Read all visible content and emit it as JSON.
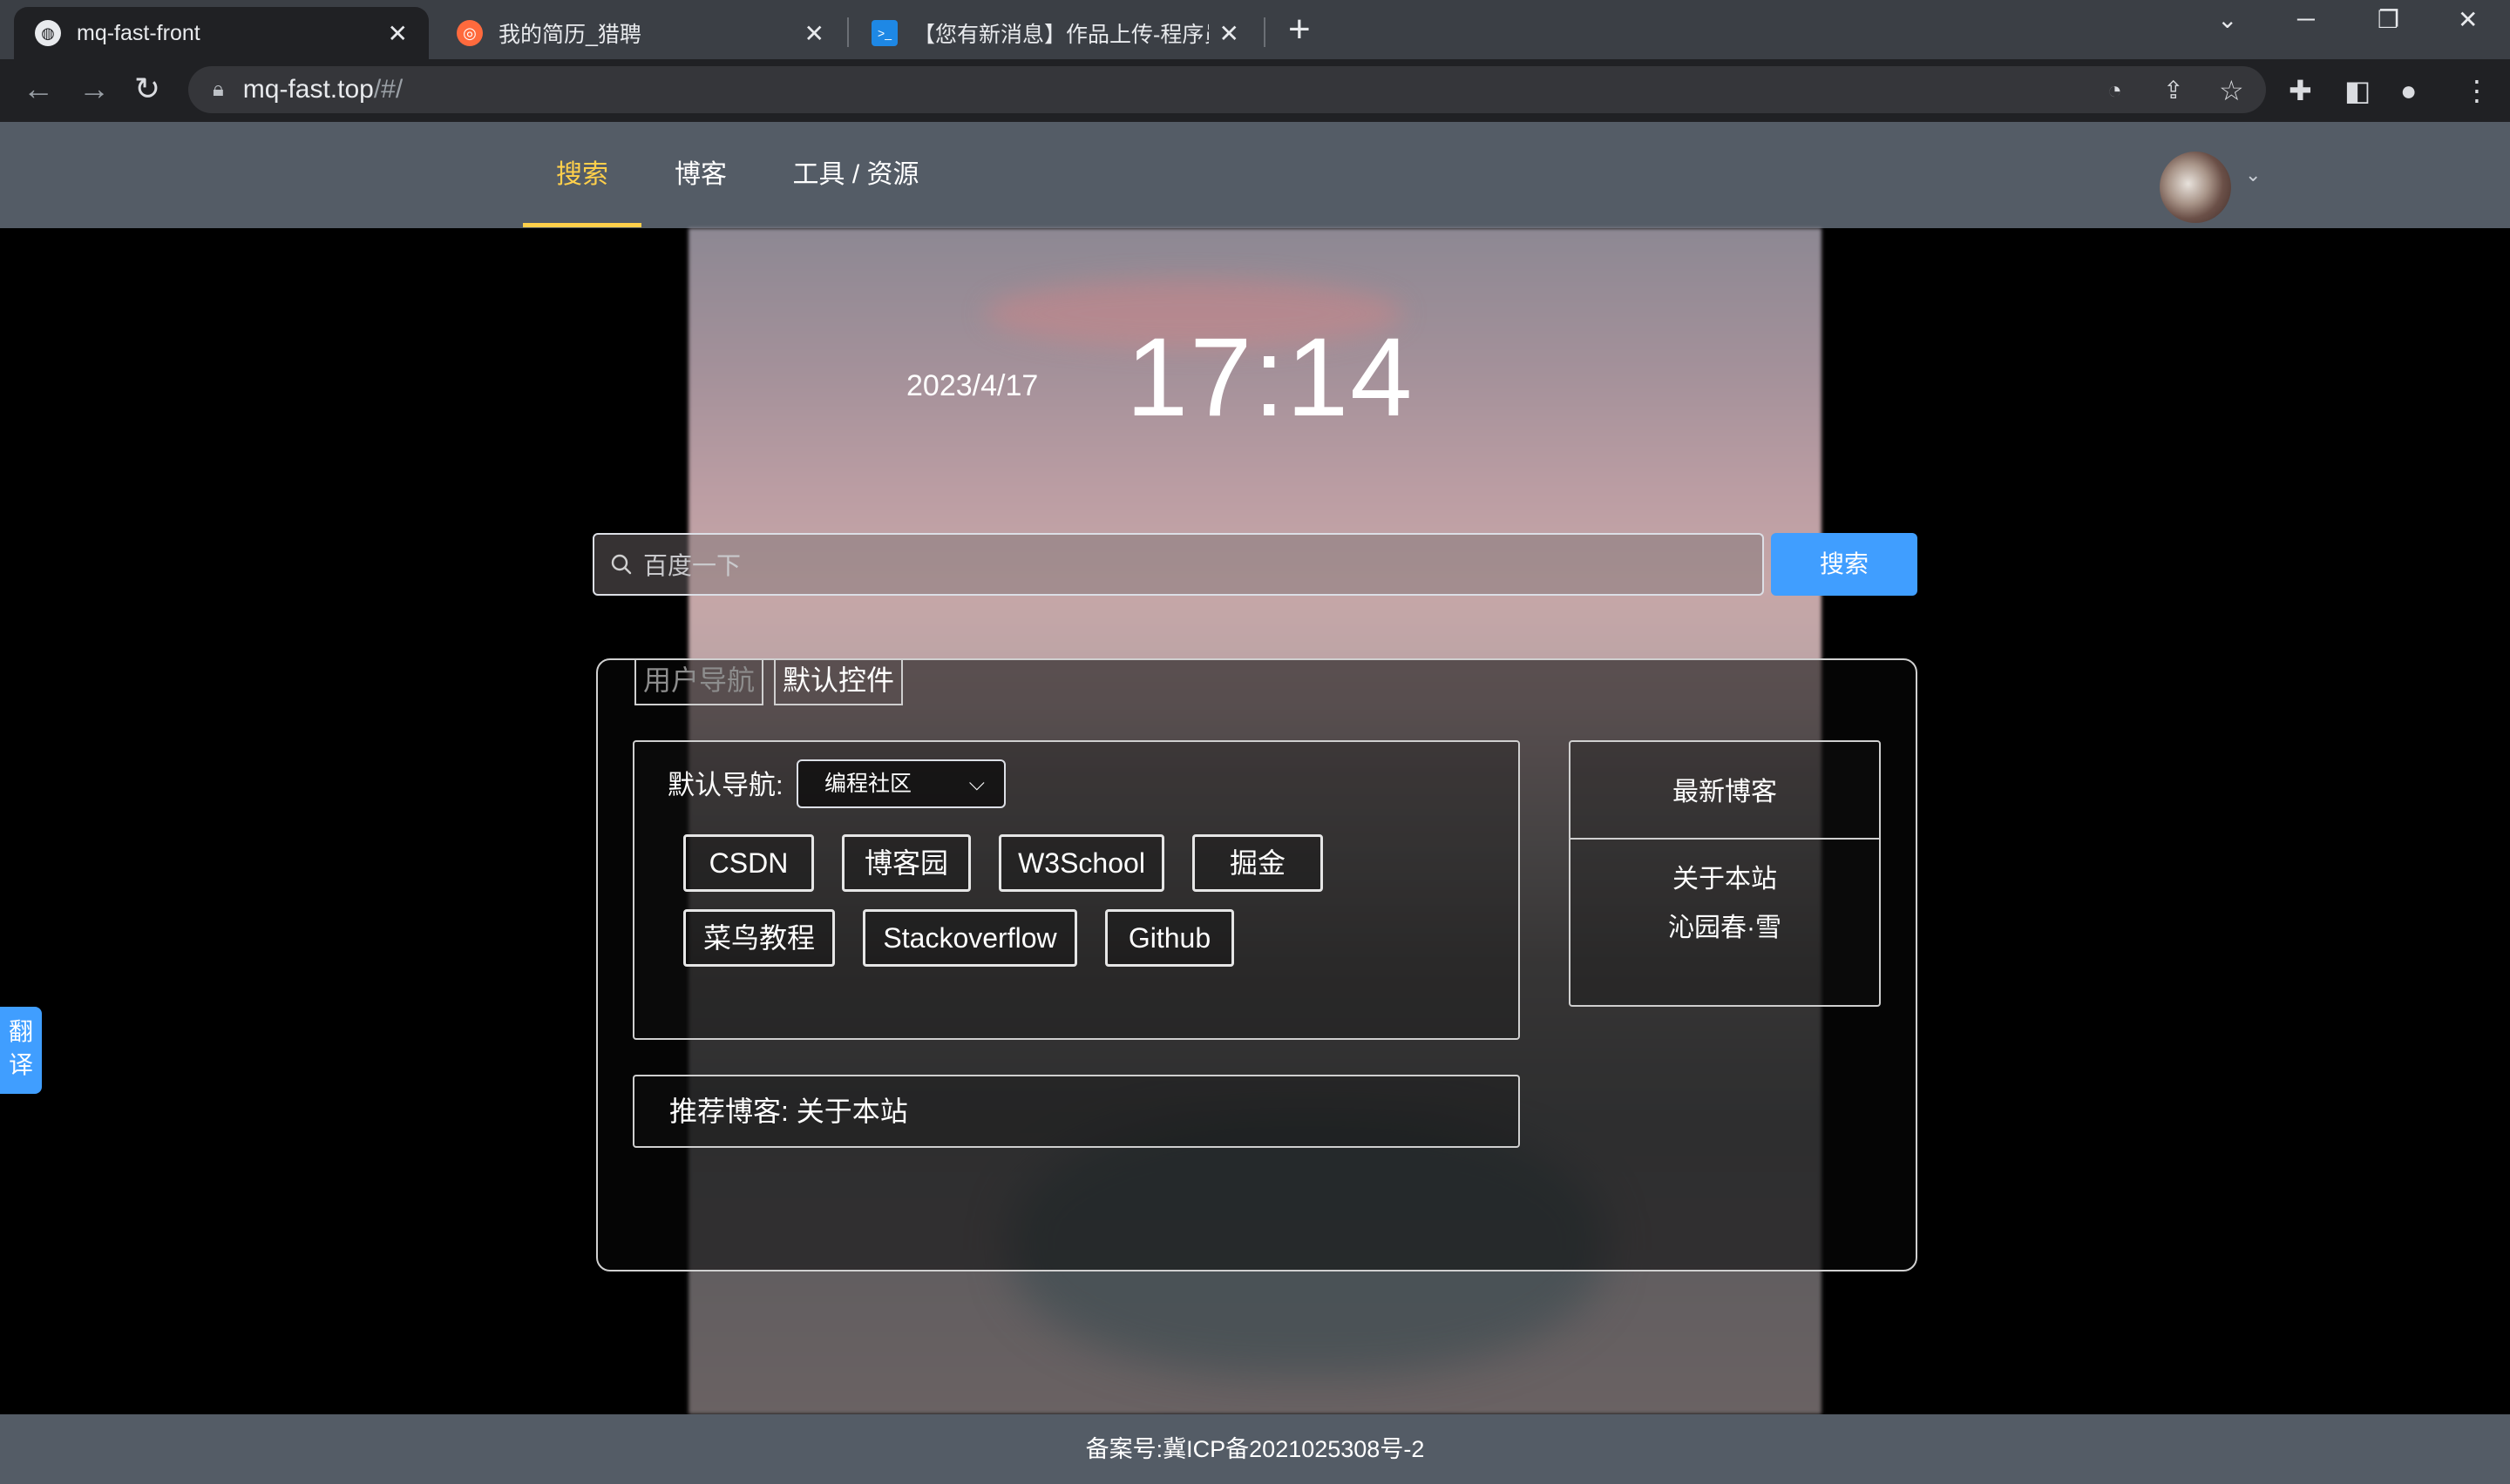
{
  "browser": {
    "tabs": [
      {
        "title": "mq-fast-front",
        "active": true
      },
      {
        "title": "我的简历_猎聘",
        "active": false
      },
      {
        "title": "【您有新消息】作品上传-程序员",
        "active": false
      }
    ],
    "url_host": "mq-fast.top",
    "url_path": "/#/",
    "new_tab": "+",
    "close_glyph": "✕"
  },
  "header": {
    "menu": [
      {
        "label": "搜索",
        "active": true
      },
      {
        "label": "博客",
        "active": false
      },
      {
        "label": "工具 / 资源",
        "active": false
      }
    ]
  },
  "clock": {
    "date": "2023/4/17",
    "time": "17:14"
  },
  "search": {
    "placeholder": "百度一下",
    "button": "搜索"
  },
  "panel": {
    "tabs": [
      {
        "label": "用户导航",
        "active": false
      },
      {
        "label": "默认控件",
        "active": true
      }
    ],
    "default_nav": {
      "label": "默认导航:",
      "selected": "编程社区",
      "links": [
        "CSDN",
        "博客园",
        "W3School",
        "掘金",
        "菜鸟教程",
        "Stackoverflow",
        "Github"
      ]
    },
    "recommend": "推荐博客: 关于本站",
    "latest_blogs": {
      "title": "最新博客",
      "items": [
        "关于本站",
        "沁园春·雪"
      ]
    }
  },
  "translate": [
    "翻",
    "译"
  ],
  "footer": "备案号:冀ICP备2021025308号-2",
  "colors": {
    "accent": "#ffd04b",
    "primary": "#409eff",
    "header_bg": "#545c66"
  }
}
